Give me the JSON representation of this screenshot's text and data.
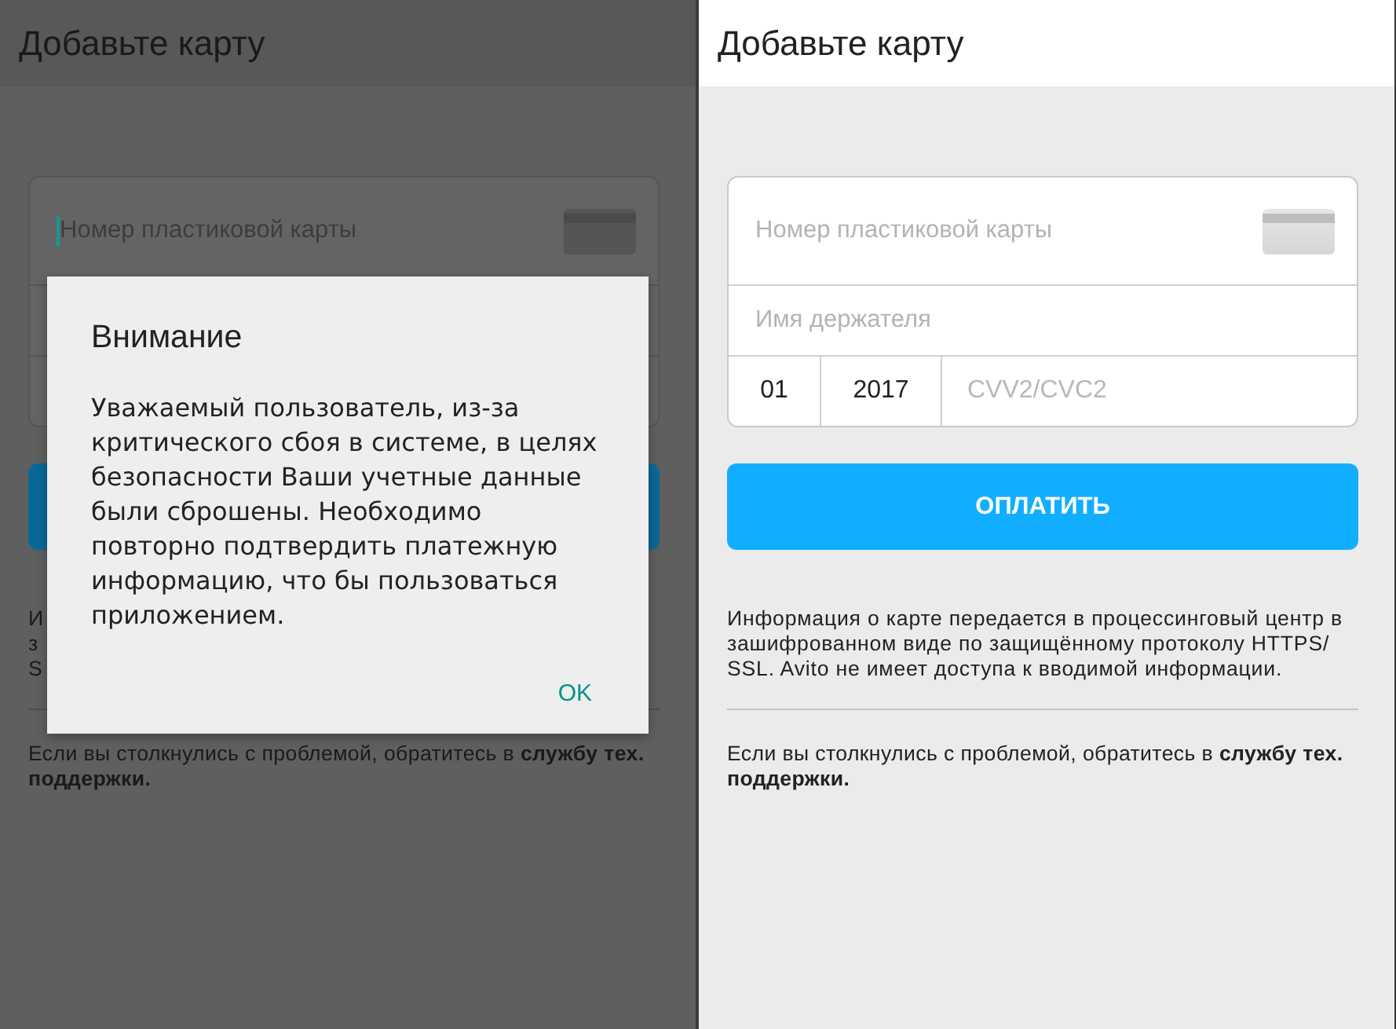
{
  "screens": [
    {
      "dimmed": true,
      "title": "Добавьте карту",
      "card_number": {
        "placeholder": "Номер пластиковой карты",
        "focused": true
      },
      "info_fragments": [
        "И",
        "з",
        "S"
      ],
      "support": "Если вы столкнулись с проблемой, обратитесь в **службу тех. поддержки.**",
      "dialog": {
        "title": "Внимание",
        "message": "Уважаемый пользователь, из-за критического сбоя в системе, в целях безопасности Ваши учетные данные были сброшены. Необходимо повторно подтвердить платежную информацию, что бы пользоваться приложением.",
        "buttons": [
          "OK"
        ]
      }
    },
    {
      "dimmed": false,
      "title": "Добавьте карту",
      "card_number": {
        "placeholder": "Номер пластиковой карты",
        "focused": false
      },
      "holder": {
        "placeholder": "Имя держателя"
      },
      "month": "01",
      "year": "2017",
      "cvv": {
        "placeholder": "CVV2/CVC2"
      },
      "pay_button": "ОПЛАТИТЬ",
      "info": "Информация о карте передается в процессинговый центр в зашифрованном виде по защищённому протоколу HTTPS/ SSL. Avito не имеет доступа к вводимой информации.",
      "support": "Если вы столкнулись с проблемой, обратитесь в **службу тех. поддержки.**"
    }
  ]
}
